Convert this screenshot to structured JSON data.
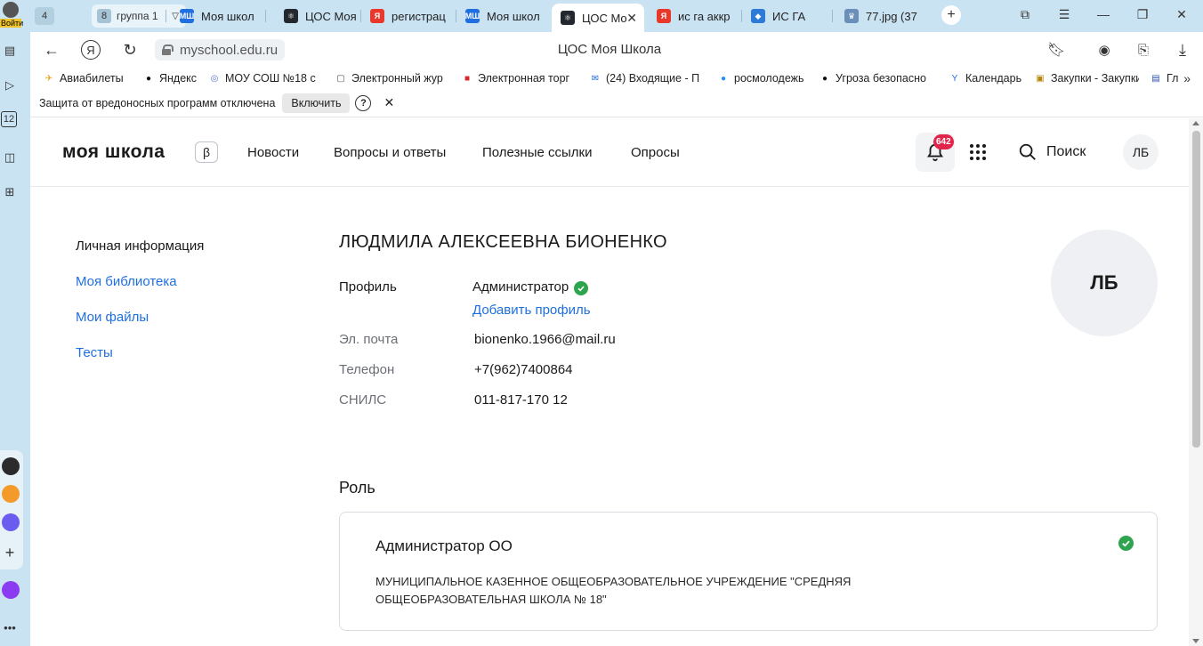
{
  "browser": {
    "login_label": "Войти",
    "tab_counter": "4",
    "group": {
      "count": "8",
      "name": "группа 1"
    },
    "tabs": [
      {
        "title": "Моя школ",
        "fav": "МШ",
        "color": "#1f6fe0"
      },
      {
        "title": "ЦОС Моя",
        "fav": "⚛",
        "color": "#23272e"
      },
      {
        "title": "регистрац",
        "fav": "Я",
        "color": "#e8382b"
      },
      {
        "title": "Моя школ",
        "fav": "МШ",
        "color": "#1f6fe0"
      },
      {
        "title": "ЦОС Мо",
        "fav": "⚛",
        "color": "#23272e"
      },
      {
        "title": "ис га аккр",
        "fav": "Я",
        "color": "#e8382b"
      },
      {
        "title": "ИС ГА",
        "fav": "◆",
        "color": "#2d7bd6"
      },
      {
        "title": "77.jpg (37",
        "fav": "♛",
        "color": "#6a8fb8"
      }
    ],
    "url": "myschool.edu.ru",
    "page_title": "ЦОС Моя Школа",
    "bookmarks": [
      {
        "label": "Авиабилеты",
        "icon": "✈"
      },
      {
        "label": "Яндекс",
        "icon": "●"
      },
      {
        "label": "МОУ СОШ №18 с",
        "icon": "◎"
      },
      {
        "label": "Электронный жур",
        "icon": "▢"
      },
      {
        "label": "Электронная торг",
        "icon": "■"
      },
      {
        "label": "(24) Входящие - П",
        "icon": "✉"
      },
      {
        "label": "росмолодежь",
        "icon": "●"
      },
      {
        "label": "Угроза безопасно",
        "icon": "●"
      },
      {
        "label": "Календарь",
        "icon": "Y"
      },
      {
        "label": "Закупки - Закупки",
        "icon": "▣"
      },
      {
        "label": "Гл",
        "icon": "▤"
      }
    ],
    "infobar": {
      "message": "Защита от вредоносных программ отключена",
      "enable_label": "Включить",
      "help": "?"
    },
    "sidebar_badge": "12"
  },
  "site": {
    "logo": "моя школа",
    "beta": "β",
    "nav": [
      "Новости",
      "Вопросы и ответы",
      "Полезные ссылки",
      "Опросы"
    ],
    "notifications_count": "642",
    "search_label": "Поиск",
    "user_initials": "ЛБ"
  },
  "side_menu": [
    {
      "label": "Личная информация",
      "active": true
    },
    {
      "label": "Моя библиотека",
      "active": false
    },
    {
      "label": "Мои файлы",
      "active": false
    },
    {
      "label": "Тесты",
      "active": false
    }
  ],
  "profile": {
    "full_name": "ЛЮДМИЛА АЛЕКСЕЕВНА БИОНЕНКО",
    "profile_label": "Профиль",
    "profile_value": "Администратор",
    "add_profile": "Добавить профиль",
    "email_label": "Эл. почта",
    "email": "bionenko.1966@mail.ru",
    "phone_label": "Телефон",
    "phone": "+7(962)7400864",
    "snils_label": "СНИЛС",
    "snils": "011-817-170 12",
    "avatar_initials": "ЛБ"
  },
  "role": {
    "heading": "Роль",
    "title": "Администратор ОО",
    "org": "МУНИЦИПАЛЬНОЕ КАЗЕННОЕ ОБЩЕОБРАЗОВАТЕЛЬНОЕ УЧРЕЖДЕНИЕ \"СРЕДНЯЯ ОБЩЕОБРАЗОВАТЕЛЬНАЯ ШКОЛА № 18\""
  },
  "colors": {
    "link": "#1f6fe0",
    "check": "#2ea44f",
    "badge": "#e2254a",
    "browser_chrome": "#c9e3f2"
  }
}
